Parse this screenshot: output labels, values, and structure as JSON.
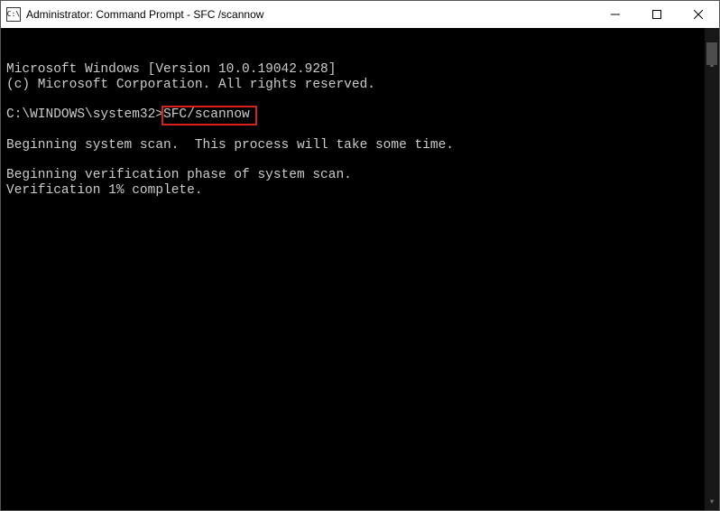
{
  "window": {
    "title": "Administrator: Command Prompt - SFC /scannow",
    "icon_label": "C:\\"
  },
  "terminal": {
    "line1": "Microsoft Windows [Version 10.0.19042.928]",
    "line2": "(c) Microsoft Corporation. All rights reserved.",
    "prompt_path": "C:\\WINDOWS\\system32>",
    "command": "SFC/scannow",
    "line_scan": "Beginning system scan.  This process will take some time.",
    "line_phase": "Beginning verification phase of system scan.",
    "line_progress": "Verification 1% complete."
  },
  "controls": {
    "minimize": "minimize",
    "maximize": "maximize",
    "close": "close"
  }
}
